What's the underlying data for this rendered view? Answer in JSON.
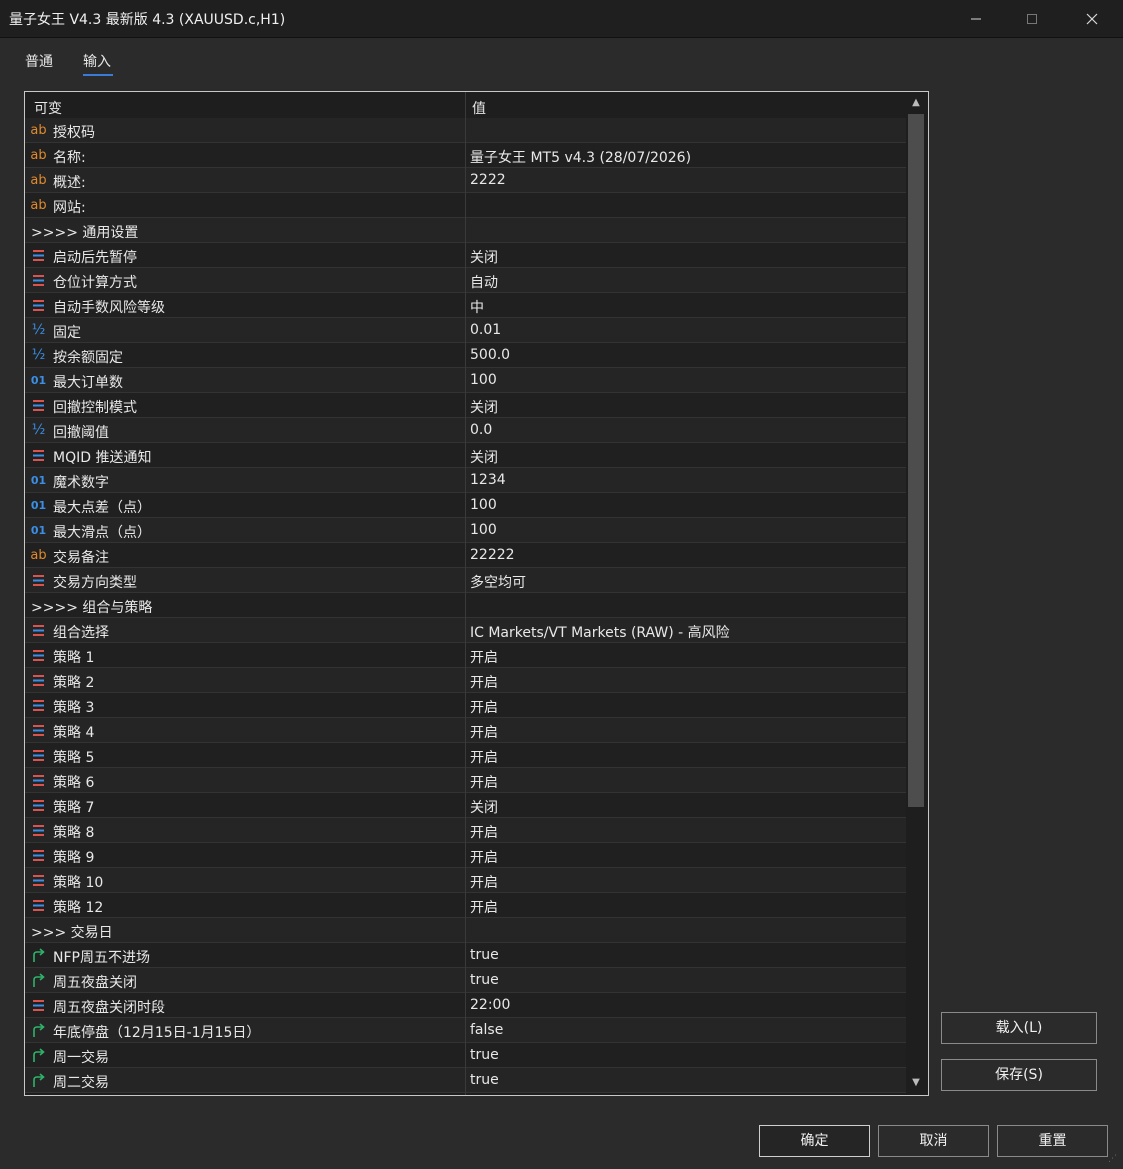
{
  "window": {
    "title": "量子女王 V4.3 最新版 4.3 (XAUUSD.c,H1)",
    "min_icon": "minimize-icon",
    "max_icon": "maximize-icon",
    "close_icon": "close-icon"
  },
  "tabs": [
    {
      "label": "普通",
      "active": false
    },
    {
      "label": "输入",
      "active": true
    }
  ],
  "grid": {
    "col_variable": "可变",
    "col_value": "值",
    "rows": [
      {
        "type": "string",
        "name": "授权码",
        "value": ""
      },
      {
        "type": "string",
        "name": "名称:",
        "value": "量子女王 MT5 v4.3 (28/07/2026)"
      },
      {
        "type": "string",
        "name": "概述:",
        "value": "2222"
      },
      {
        "type": "string",
        "name": "网站:",
        "value": ""
      },
      {
        "type": "section",
        "name": ">>>> 通用设置",
        "value": ""
      },
      {
        "type": "enum",
        "name": "启动后先暂停",
        "value": "关闭"
      },
      {
        "type": "enum",
        "name": "仓位计算方式",
        "value": "自动"
      },
      {
        "type": "enum",
        "name": "自动手数风险等级",
        "value": "中"
      },
      {
        "type": "double",
        "name": "固定",
        "value": "0.01"
      },
      {
        "type": "double",
        "name": "按余额固定",
        "value": "500.0"
      },
      {
        "type": "int",
        "name": "最大订单数",
        "value": "100"
      },
      {
        "type": "enum",
        "name": "回撤控制模式",
        "value": "关闭"
      },
      {
        "type": "double",
        "name": "回撤阈值",
        "value": "0.0"
      },
      {
        "type": "enum",
        "name": "MQID 推送通知",
        "value": "关闭"
      },
      {
        "type": "int",
        "name": "魔术数字",
        "value": "1234"
      },
      {
        "type": "int",
        "name": "最大点差（点）",
        "value": "100"
      },
      {
        "type": "int",
        "name": "最大滑点（点）",
        "value": "100"
      },
      {
        "type": "string",
        "name": "交易备注",
        "value": "22222"
      },
      {
        "type": "enum",
        "name": "交易方向类型",
        "value": "多空均可"
      },
      {
        "type": "section",
        "name": ">>>> 组合与策略",
        "value": ""
      },
      {
        "type": "enum",
        "name": "组合选择",
        "value": "IC Markets/VT Markets (RAW) - 高风险"
      },
      {
        "type": "enum",
        "name": "策略 1",
        "value": "开启"
      },
      {
        "type": "enum",
        "name": "策略 2",
        "value": "开启"
      },
      {
        "type": "enum",
        "name": "策略 3",
        "value": "开启"
      },
      {
        "type": "enum",
        "name": "策略 4",
        "value": "开启"
      },
      {
        "type": "enum",
        "name": "策略 5",
        "value": "开启"
      },
      {
        "type": "enum",
        "name": "策略 6",
        "value": "开启"
      },
      {
        "type": "enum",
        "name": "策略 7",
        "value": "关闭"
      },
      {
        "type": "enum",
        "name": "策略 8",
        "value": "开启"
      },
      {
        "type": "enum",
        "name": "策略 9",
        "value": "开启"
      },
      {
        "type": "enum",
        "name": "策略 10",
        "value": "开启"
      },
      {
        "type": "enum",
        "name": "策略 12",
        "value": "开启"
      },
      {
        "type": "section",
        "name": ">>> 交易日",
        "value": ""
      },
      {
        "type": "bool",
        "name": "NFP周五不进场",
        "value": "true"
      },
      {
        "type": "bool",
        "name": "周五夜盘关闭",
        "value": "true"
      },
      {
        "type": "enum",
        "name": "周五夜盘关闭时段",
        "value": "22:00"
      },
      {
        "type": "bool",
        "name": "年底停盘（12月15日-1月15日）",
        "value": "false"
      },
      {
        "type": "bool",
        "name": "周一交易",
        "value": "true"
      },
      {
        "type": "bool",
        "name": "周二交易",
        "value": "true"
      }
    ]
  },
  "buttons": {
    "load": "载入(L)",
    "save": "保存(S)",
    "ok": "确定",
    "cancel": "取消",
    "reset": "重置"
  },
  "icon_names": {
    "string": "string-ab-icon",
    "enum": "enum-list-icon",
    "double": "double-half-icon",
    "int": "integer-01-icon",
    "bool": "bool-arrow-icon"
  },
  "colors": {
    "string_icon": "#e08a2c",
    "numeric_icon": "#3b8fe6",
    "enum_icon_red": "#d9534f",
    "enum_icon_blue": "#3b8fe6",
    "bool_icon": "#2fb36b"
  }
}
